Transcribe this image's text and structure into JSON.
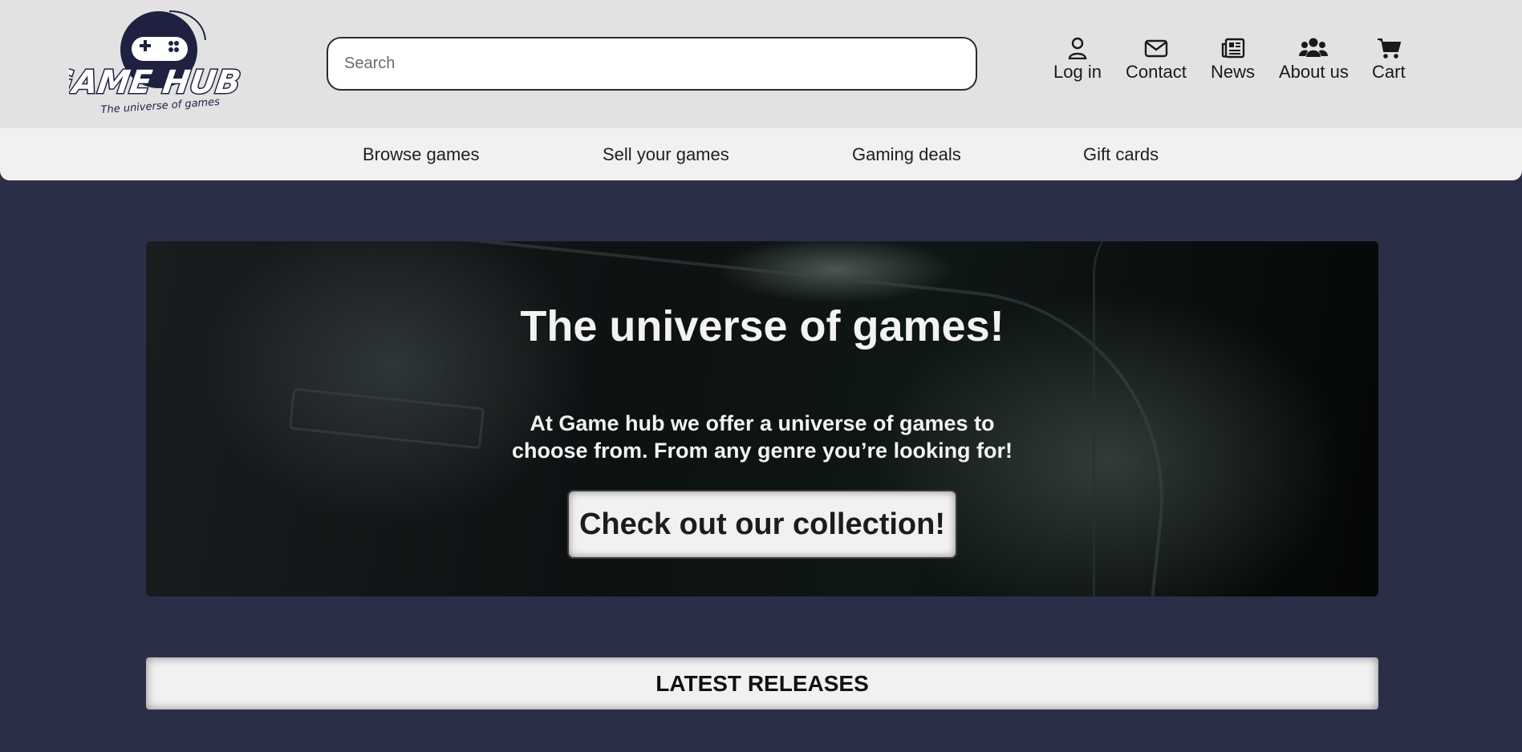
{
  "header": {
    "logo": {
      "wordmark": "GAME HUB",
      "tagline": "The universe of games"
    },
    "search": {
      "placeholder": "Search",
      "value": ""
    },
    "links": [
      {
        "label": "Log in",
        "icon": "user-icon"
      },
      {
        "label": "Contact",
        "icon": "envelope-icon"
      },
      {
        "label": "News",
        "icon": "newspaper-icon"
      },
      {
        "label": "About us",
        "icon": "users-icon"
      },
      {
        "label": "Cart",
        "icon": "cart-icon"
      }
    ]
  },
  "nav": {
    "items": [
      {
        "label": "Browse games"
      },
      {
        "label": "Sell your games"
      },
      {
        "label": "Gaming deals"
      },
      {
        "label": "Gift cards"
      }
    ]
  },
  "hero": {
    "title": "The universe of games!",
    "text": "At Game hub we offer a universe of games to choose from. From any genre you’re looking for!",
    "button_label": "Check out our collection!"
  },
  "latest": {
    "heading": "LATEST RELEASES"
  },
  "colors": {
    "page_background": "#2a2f47",
    "header_background": "#e2e2e3",
    "nav_background": "#f2f0f1",
    "logo_navy": "#1e2240"
  }
}
